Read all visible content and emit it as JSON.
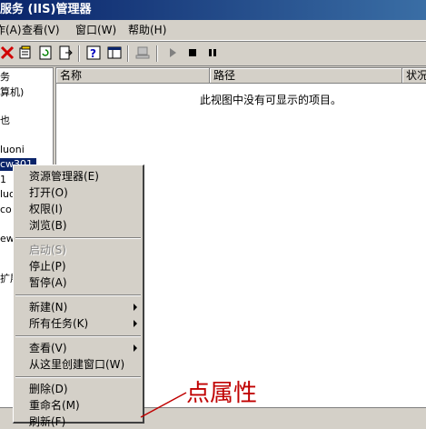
{
  "window": {
    "title": "服务 (IIS)管理器"
  },
  "menu": {
    "items": [
      {
        "label": "作(A)",
        "name": "menu-action"
      },
      {
        "label": "查看(V)",
        "name": "menu-view"
      },
      {
        "label": "窗口(W)",
        "name": "menu-window"
      },
      {
        "label": "帮助(H)",
        "name": "menu-help"
      }
    ]
  },
  "toolbar": {
    "icons": [
      "delete-icon",
      "properties-icon",
      "refresh-icon",
      "export-icon",
      "help-icon",
      "show-hide-icon",
      "connect-icon",
      "play-icon",
      "stop-icon",
      "pause-icon"
    ]
  },
  "tree": {
    "nodes": [
      {
        "label": "务",
        "name": "tree-node-services"
      },
      {
        "label": "算机)",
        "name": "tree-node-local-computer"
      },
      {
        "label": "也",
        "name": "tree-node-app-pools"
      },
      {
        "label": "luoni",
        "name": "tree-node-site-luoni"
      },
      {
        "label": "cw301",
        "name": "tree-node-site-cw301",
        "selected": true
      },
      {
        "label": "1",
        "name": "tree-node-site-1"
      },
      {
        "label": "luo",
        "name": "tree-node-site-luo"
      },
      {
        "label": "co",
        "name": "tree-node-site-co"
      },
      {
        "label": "ew",
        "name": "tree-node-site-ew"
      },
      {
        "label": "扩展",
        "name": "tree-node-extensions"
      }
    ]
  },
  "list": {
    "columns": [
      "名称",
      "路径",
      "状况"
    ],
    "empty_message": "此视图中没有可显示的项目。"
  },
  "context_menu": {
    "groups": [
      [
        {
          "label": "资源管理器(E)",
          "name": "ctx-explore"
        },
        {
          "label": "打开(O)",
          "name": "ctx-open"
        },
        {
          "label": "权限(I)",
          "name": "ctx-permissions"
        },
        {
          "label": "浏览(B)",
          "name": "ctx-browse"
        }
      ],
      [
        {
          "label": "启动(S)",
          "name": "ctx-start",
          "disabled": true
        },
        {
          "label": "停止(P)",
          "name": "ctx-stop"
        },
        {
          "label": "暂停(A)",
          "name": "ctx-pause"
        }
      ],
      [
        {
          "label": "新建(N)",
          "name": "ctx-new",
          "submenu": true
        },
        {
          "label": "所有任务(K)",
          "name": "ctx-all-tasks",
          "submenu": true
        }
      ],
      [
        {
          "label": "查看(V)",
          "name": "ctx-view",
          "submenu": true
        },
        {
          "label": "从这里创建窗口(W)",
          "name": "ctx-new-window"
        }
      ],
      [
        {
          "label": "删除(D)",
          "name": "ctx-delete"
        },
        {
          "label": "重命名(M)",
          "name": "ctx-rename"
        },
        {
          "label": "刷新(F)",
          "name": "ctx-refresh"
        }
      ]
    ]
  },
  "annotation": {
    "text": "点属性",
    "color": "#c00000"
  }
}
